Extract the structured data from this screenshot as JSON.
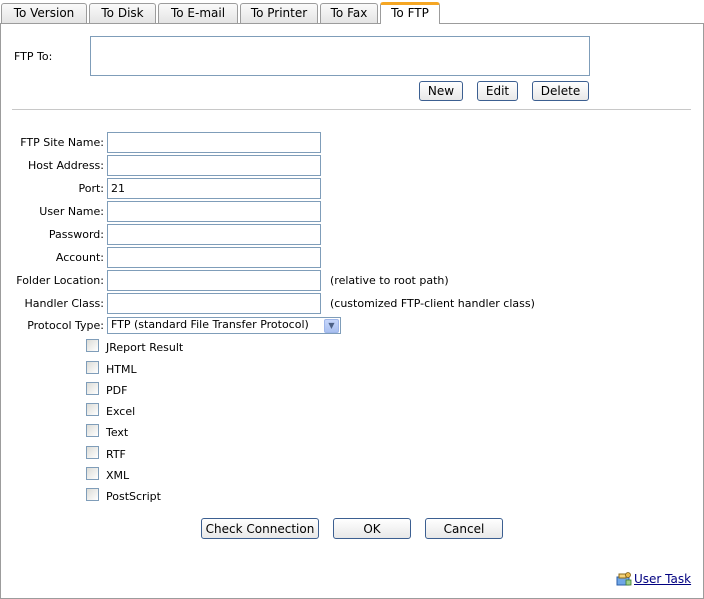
{
  "tabs": [
    {
      "label": "To Version"
    },
    {
      "label": "To Disk"
    },
    {
      "label": "To E-mail"
    },
    {
      "label": "To Printer"
    },
    {
      "label": "To Fax"
    },
    {
      "label": "To FTP",
      "active": true
    }
  ],
  "ftp_to": {
    "label": "FTP To:",
    "buttons": {
      "new": "New",
      "edit": "Edit",
      "delete": "Delete"
    }
  },
  "form": {
    "site_name": {
      "label": "FTP Site Name:",
      "value": ""
    },
    "host": {
      "label": "Host Address:",
      "value": ""
    },
    "port": {
      "label": "Port:",
      "value": "21"
    },
    "user": {
      "label": "User Name:",
      "value": ""
    },
    "password": {
      "label": "Password:",
      "value": ""
    },
    "account": {
      "label": "Account:",
      "value": ""
    },
    "folder": {
      "label": "Folder Location:",
      "value": "",
      "hint": "(relative to root path)"
    },
    "handler": {
      "label": "Handler Class:",
      "value": "",
      "hint": "(customized FTP-client handler class)"
    },
    "protocol": {
      "label": "Protocol Type:",
      "value": "FTP (standard File Transfer Protocol)"
    }
  },
  "formats": [
    {
      "label": "JReport Result",
      "checked": false
    },
    {
      "label": "HTML",
      "checked": false
    },
    {
      "label": "PDF",
      "checked": false
    },
    {
      "label": "Excel",
      "checked": false
    },
    {
      "label": "Text",
      "checked": false
    },
    {
      "label": "RTF",
      "checked": false
    },
    {
      "label": "XML",
      "checked": false
    },
    {
      "label": "PostScript",
      "checked": false
    }
  ],
  "actions": {
    "check": "Check Connection",
    "ok": "OK",
    "cancel": "Cancel"
  },
  "footer": {
    "user_task": "User Task",
    "icon": "user-task-icon"
  },
  "colors": {
    "active_tab_accent": "#f5a623",
    "field_border": "#7f9db9",
    "link": "#000080"
  }
}
